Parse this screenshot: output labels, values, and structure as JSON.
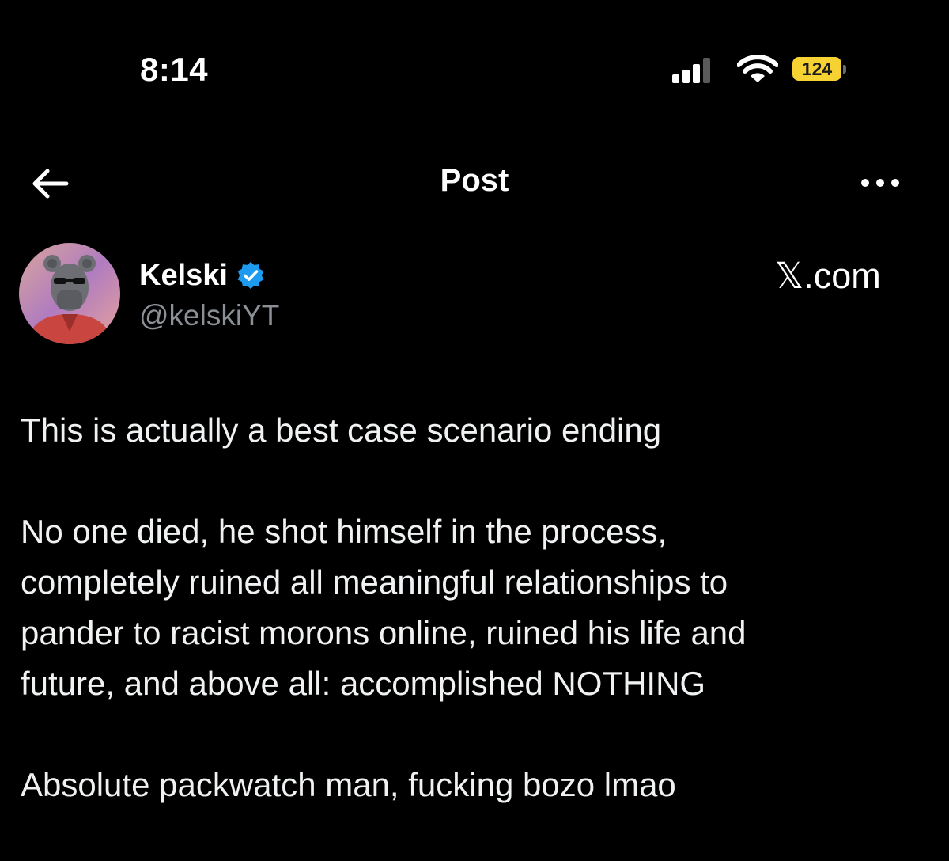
{
  "status_bar": {
    "time": "8:14",
    "battery_level": "124",
    "signal_icon": "cellular-signal-icon",
    "wifi_icon": "wifi-icon",
    "battery_icon": "battery-charging-icon",
    "battery_color": "#f7d233"
  },
  "header": {
    "title": "Post",
    "back_icon": "arrow-left-icon",
    "more_icon": "ellipsis-icon"
  },
  "author": {
    "name": "Kelski",
    "handle": "@kelskiYT",
    "verified": true,
    "verified_color": "#1d9bf0"
  },
  "watermark": {
    "text": "𝕏.com"
  },
  "post": {
    "paragraphs": [
      "This is actually a best case scenario ending",
      "No one died, he shot himself in the process,\ncompletely ruined all meaningful relationships to\npander to racist morons online, ruined his life and\nfuture, and above all: accomplished NOTHING",
      "Absolute packwatch man, fucking bozo lmao"
    ]
  },
  "colors": {
    "background": "#000000",
    "text_primary": "#e7e9ea",
    "text_secondary": "#8b9096"
  }
}
